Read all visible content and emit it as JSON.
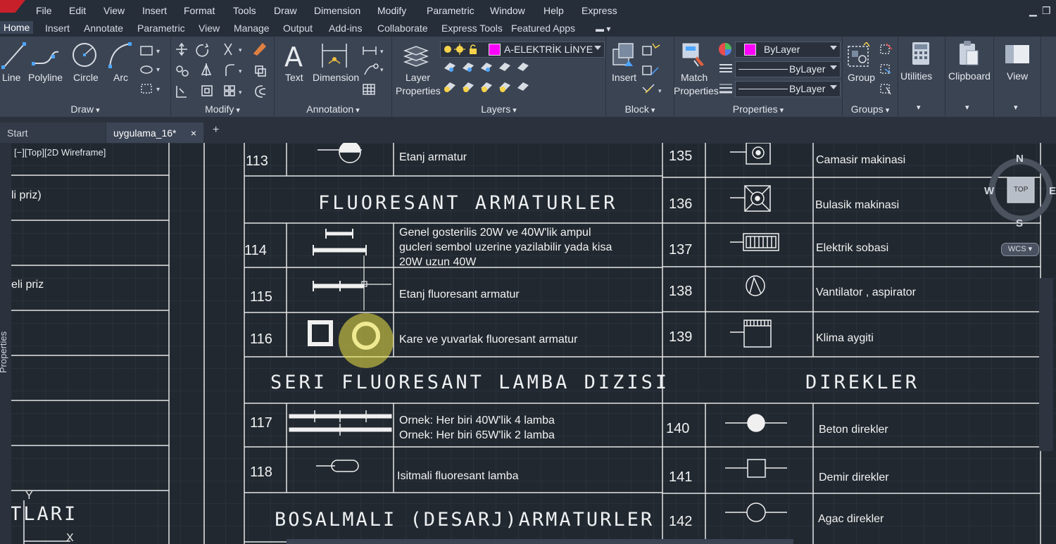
{
  "menubar": {
    "items": [
      "File",
      "Edit",
      "View",
      "Insert",
      "Format",
      "Tools",
      "Draw",
      "Dimension",
      "Modify",
      "Parametric",
      "Window",
      "Help",
      "Express"
    ]
  },
  "ribbon_tabs": [
    "Home",
    "Insert",
    "Annotate",
    "Parametric",
    "View",
    "Manage",
    "Output",
    "Add-ins",
    "Collaborate",
    "Express Tools",
    "Featured Apps"
  ],
  "ribbon": {
    "draw": {
      "title": "Draw",
      "line": "Line",
      "polyline": "Polyline",
      "circle": "Circle",
      "arc": "Arc"
    },
    "modify": {
      "title": "Modify"
    },
    "annotation": {
      "title": "Annotation",
      "text": "Text",
      "dimension": "Dimension"
    },
    "layers": {
      "title": "Layers",
      "layer_properties_1": "Layer",
      "layer_properties_2": "Properties",
      "current_layer": "A-ELEKTRİK LİNYE"
    },
    "block": {
      "title": "Block",
      "insert": "Insert"
    },
    "properties": {
      "title": "Properties",
      "match_1": "Match",
      "match_2": "Properties",
      "color": "ByLayer",
      "linetype": "ByLayer",
      "lineweight": "ByLayer"
    },
    "groups": {
      "title": "Groups",
      "group": "Group"
    },
    "utilities": {
      "label": "Utilities"
    },
    "clipboard": {
      "label": "Clipboard"
    },
    "view": {
      "label": "View"
    }
  },
  "doc_tabs": {
    "start": "Start",
    "file": "uygulama_16*",
    "close": "×",
    "add": "+"
  },
  "viewport": {
    "label": "[−][Top][2D Wireframe]"
  },
  "left_panel": {
    "label": "Properties"
  },
  "viewcube": {
    "n": "N",
    "s": "S",
    "w": "W",
    "e": "E",
    "top": "TOP",
    "wcs": "WCS"
  },
  "left_table": {
    "row1": "li priz)",
    "row2": "eli priz",
    "row3": "TLARI"
  },
  "ucs": {
    "y": "Y",
    "x": "X"
  },
  "legend": {
    "rows_left": [
      {
        "num": "113",
        "desc": "Etanj armatur"
      },
      {
        "num": "114",
        "desc": "Genel gosterilis 20W ve 40W'lik ampul gucleri sembol uzerine yazilabilir yada kisa 20W uzun 40W"
      },
      {
        "num": "115",
        "desc": "Etanj fluoresant armatur"
      },
      {
        "num": "116",
        "desc": "Kare ve yuvarlak fluoresant armatur"
      },
      {
        "num": "117",
        "desc_1": "Ornek: Her biri 40W'lik 4 lamba",
        "desc_2": "Ornek: Her biri 65W'lik 2 lamba"
      },
      {
        "num": "118",
        "desc": "Isitmali fluoresant lamba"
      }
    ],
    "headers": {
      "fluoresant": "FLUORESANT ARMATURLER",
      "seri": "SERI FLUORESANT LAMBA DIZISI",
      "direkler": "DIREKLER",
      "bosalmali": "BOSALMALI (DESARJ)ARMATURLER"
    },
    "rows_right": [
      {
        "num": "135",
        "desc": "Camasir makinasi"
      },
      {
        "num": "136",
        "desc": "Bulasik makinasi"
      },
      {
        "num": "137",
        "desc": "Elektrik sobasi"
      },
      {
        "num": "138",
        "desc": "Vantilator , aspirator"
      },
      {
        "num": "139",
        "desc": "Klima aygiti"
      },
      {
        "num": "140",
        "desc": "Beton direkler"
      },
      {
        "num": "141",
        "desc": "Demir direkler"
      },
      {
        "num": "142",
        "desc": "Agac direkler"
      }
    ]
  },
  "colors": {
    "accent": "#ff00ff",
    "highlight": "#eee446",
    "background": "#212830",
    "ribbon": "#3b4453"
  }
}
